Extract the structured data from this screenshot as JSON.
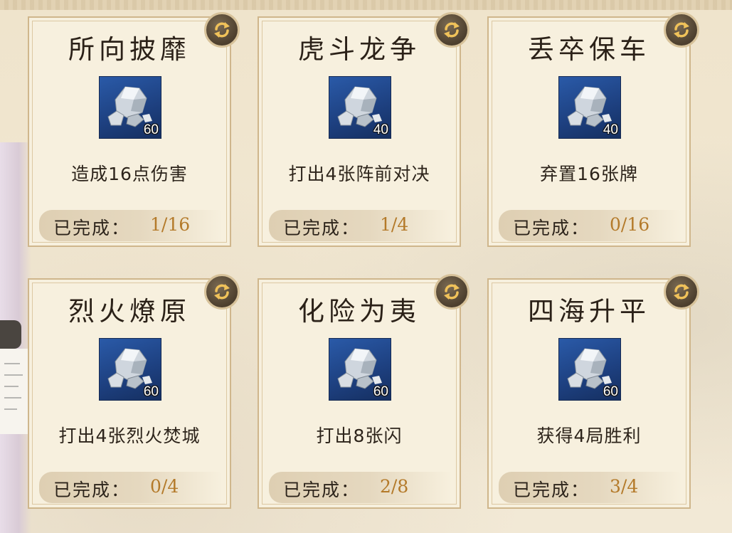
{
  "completed_label": "已完成：",
  "colors": {
    "title": "#2b2118",
    "progress_value": "#b47a2a",
    "card_background": "#f7f0de",
    "card_border": "#cfb68c",
    "icon_background": "#1d3f7e"
  },
  "tasks": [
    {
      "title": "所向披靡",
      "reward_count": "60",
      "description": "造成16点伤害",
      "progress": "1/16",
      "reward_icon": "silver-ore-icon",
      "refresh_icon": "refresh-icon"
    },
    {
      "title": "虎斗龙争",
      "reward_count": "40",
      "description": "打出4张阵前对决",
      "progress": "1/4",
      "reward_icon": "silver-ore-icon",
      "refresh_icon": "refresh-icon"
    },
    {
      "title": "丢卒保车",
      "reward_count": "40",
      "description": "弃置16张牌",
      "progress": "0/16",
      "reward_icon": "silver-ore-icon",
      "refresh_icon": "refresh-icon"
    },
    {
      "title": "烈火燎原",
      "reward_count": "60",
      "description": "打出4张烈火焚城",
      "progress": "0/4",
      "reward_icon": "silver-ore-icon",
      "refresh_icon": "refresh-icon"
    },
    {
      "title": "化险为夷",
      "reward_count": "60",
      "description": "打出8张闪",
      "progress": "2/8",
      "reward_icon": "silver-ore-icon",
      "refresh_icon": "refresh-icon"
    },
    {
      "title": "四海升平",
      "reward_count": "60",
      "description": "获得4局胜利",
      "progress": "3/4",
      "reward_icon": "silver-ore-icon",
      "refresh_icon": "refresh-icon"
    }
  ]
}
